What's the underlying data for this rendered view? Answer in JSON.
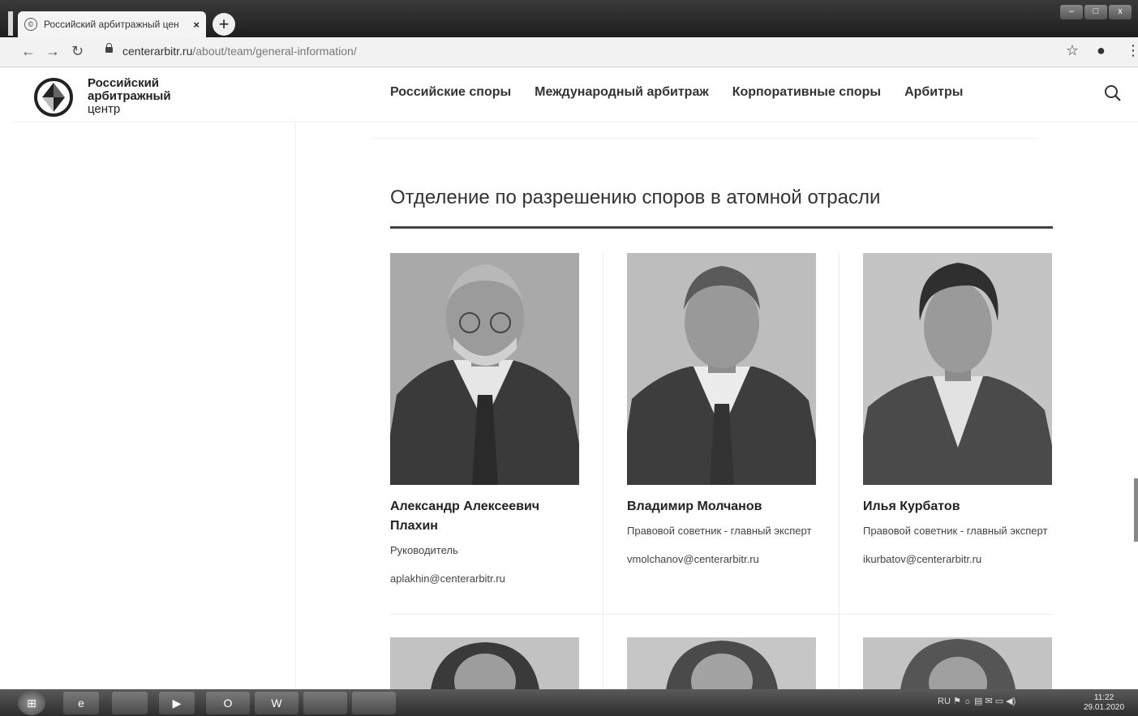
{
  "browser": {
    "tab_title": "Российский арбитражный цен",
    "tab_favicon": "©",
    "tab_close": "×",
    "new_tab": "+",
    "window_controls": {
      "minimize": "–",
      "maximize": "□",
      "close": "x"
    },
    "url_host": "centerarbitr.ru",
    "url_path": "/about/team/general-information/",
    "icons": {
      "back": "arrow-left-icon",
      "forward": "arrow-right-icon",
      "reload": "reload-icon",
      "lock": "lock-icon",
      "bookmark": "star-icon",
      "profile": "account-icon",
      "menu": "kebab-menu-icon"
    }
  },
  "site": {
    "logo": {
      "line1": "Российский",
      "line2": "арбитражный",
      "line3": "центр"
    },
    "nav": [
      {
        "label": "Российские споры"
      },
      {
        "label": "Международный арбитраж"
      },
      {
        "label": "Корпоративные споры"
      },
      {
        "label": "Арбитры"
      }
    ],
    "search_icon": "search-icon"
  },
  "section": {
    "title": "Отделение по разрешению споров в атомной отрасли",
    "members": [
      {
        "name": "Александр Алексеевич Плахин",
        "role": "Руководитель",
        "email": "aplakhin@centerarbitr.ru"
      },
      {
        "name": "Владимир Молчанов",
        "role": "Правовой советник - главный эксперт",
        "email": "vmolchanov@centerarbitr.ru"
      },
      {
        "name": "Илья Курбатов",
        "role": "Правовой советник - главный эксперт",
        "email": "ikurbatov@centerarbitr.ru"
      }
    ]
  },
  "taskbar": {
    "items": [
      "e",
      "",
      "▶",
      "O",
      "W",
      "",
      ""
    ],
    "tray_lang": "RU",
    "clock_time": "11:22",
    "clock_date": "29.01.2020"
  },
  "colors": {
    "accent": "#444444",
    "chrome_dark": "#2a2a2a",
    "page_bg": "#ffffff"
  }
}
